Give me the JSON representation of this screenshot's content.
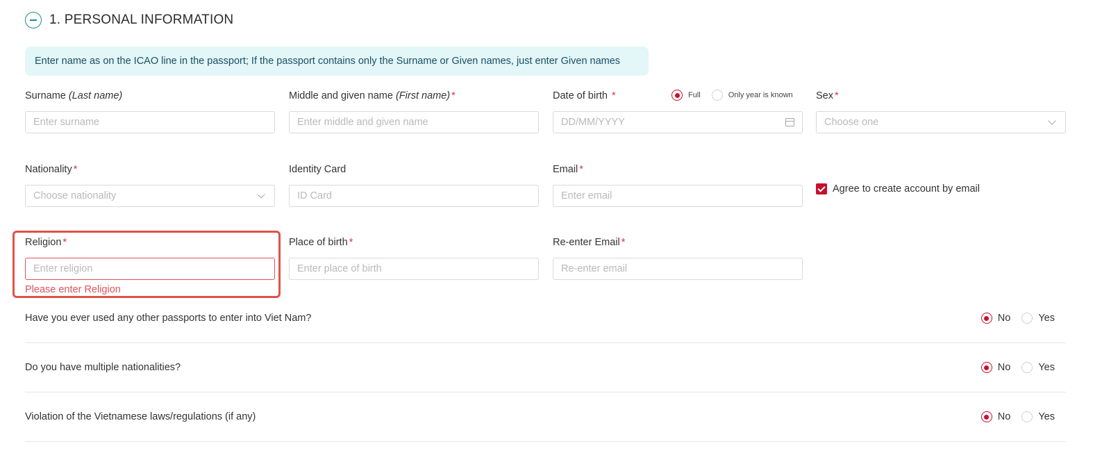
{
  "section": {
    "title": "1. PERSONAL INFORMATION"
  },
  "notice": "Enter name as on the ICAO line in the passport; If the passport contains only the Surname or Given names, just enter Given names",
  "fields": {
    "surname": {
      "label": "Surname",
      "label_hint": "(Last name)",
      "placeholder": "Enter surname"
    },
    "given_name": {
      "label": "Middle and given name",
      "label_hint": "(First name)",
      "required_mark": "*",
      "placeholder": "Enter middle and given name"
    },
    "dob": {
      "label": "Date of birth",
      "required_mark": "*",
      "placeholder": "DD/MM/YYYY",
      "option_full": "Full",
      "option_year": "Only year is known",
      "selected": "Full"
    },
    "sex": {
      "label": "Sex",
      "required_mark": "*",
      "placeholder": "Choose one"
    },
    "nationality": {
      "label": "Nationality",
      "required_mark": "*",
      "placeholder": "Choose nationality"
    },
    "identity_card": {
      "label": "Identity Card",
      "placeholder": "ID Card"
    },
    "email": {
      "label": "Email",
      "required_mark": "*",
      "placeholder": "Enter email"
    },
    "agree": {
      "label": "Agree to create account by email",
      "checked": true
    },
    "religion": {
      "label": "Religion",
      "required_mark": "*",
      "placeholder": "Enter religion",
      "error": "Please enter Religion"
    },
    "place_of_birth": {
      "label": "Place of birth",
      "required_mark": "*",
      "placeholder": "Enter place of birth"
    },
    "reenter_email": {
      "label": "Re-enter Email",
      "required_mark": "*",
      "placeholder": "Re-enter email"
    }
  },
  "questions": [
    {
      "text": "Have you ever used any other passports to enter into Viet Nam?",
      "no": "No",
      "yes": "Yes",
      "selected": "No"
    },
    {
      "text": "Do you have multiple nationalities?",
      "no": "No",
      "yes": "Yes",
      "selected": "No"
    },
    {
      "text": "Violation of the Vietnamese laws/regulations (if any)",
      "no": "No",
      "yes": "Yes",
      "selected": "No"
    }
  ],
  "colors": {
    "accent": "#c8102e",
    "teal": "#1f8a8a",
    "notice_bg": "#e3f6f8",
    "error": "#e0525a"
  }
}
